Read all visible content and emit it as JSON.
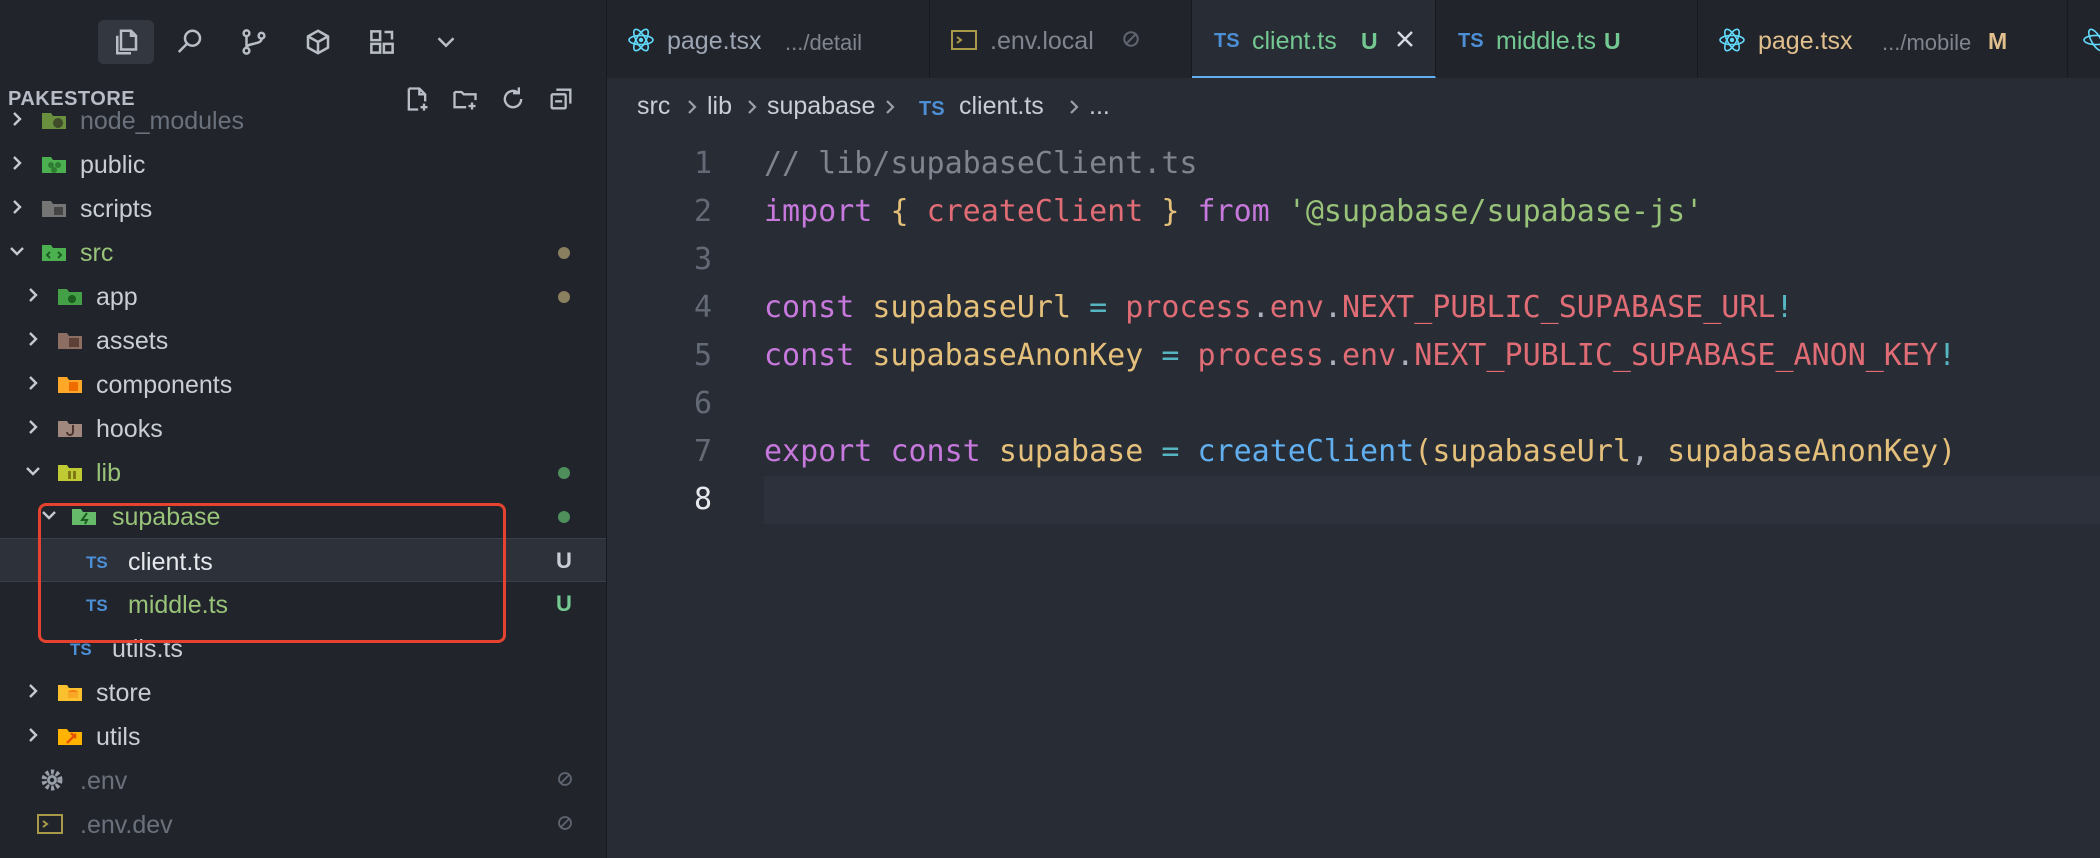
{
  "sidebar": {
    "explorer_title": "PAKESTORE",
    "activity_icons": [
      "explorer-icon",
      "search-icon",
      "source-control-icon",
      "extensions-icon",
      "remote-explorer-icon",
      "more-chevron-icon"
    ],
    "header_actions": [
      "new-file-icon",
      "new-folder-icon",
      "refresh-icon",
      "collapse-all-icon"
    ],
    "tree": [
      {
        "label": "node_modules",
        "type": "folder",
        "expanded": false
      },
      {
        "label": "public",
        "type": "folder",
        "expanded": false
      },
      {
        "label": "scripts",
        "type": "folder",
        "expanded": false
      },
      {
        "label": "src",
        "type": "folder",
        "expanded": true
      },
      {
        "label": "app",
        "type": "folder",
        "expanded": false
      },
      {
        "label": "assets",
        "type": "folder",
        "expanded": false
      },
      {
        "label": "components",
        "type": "folder",
        "expanded": false
      },
      {
        "label": "hooks",
        "type": "folder",
        "expanded": false
      },
      {
        "label": "lib",
        "type": "folder",
        "expanded": true
      },
      {
        "label": "supabase",
        "type": "folder",
        "expanded": true
      },
      {
        "label": "client.ts",
        "type": "file",
        "lang_badge": "TS",
        "status": "U",
        "selected": true
      },
      {
        "label": "middle.ts",
        "type": "file",
        "lang_badge": "TS",
        "status": "U"
      },
      {
        "label": "utils.ts",
        "type": "file",
        "lang_badge": "TS"
      },
      {
        "label": "store",
        "type": "folder",
        "expanded": false
      },
      {
        "label": "utils",
        "type": "folder",
        "expanded": false
      },
      {
        "label": ".env",
        "type": "file",
        "ignored": true
      },
      {
        "label": ".env.dev",
        "type": "file",
        "ignored": true
      }
    ],
    "status_colors": {
      "untracked": "#73c991",
      "modified_dot": "#8a7f5e",
      "green_dot": "#4e8f5c"
    }
  },
  "tabs": [
    {
      "label": "page.tsx",
      "description": ".../detail",
      "icon": "react-icon"
    },
    {
      "label": ".env.local",
      "icon": "terminal-icon"
    },
    {
      "label": "client.ts",
      "status": "U",
      "icon": "ts-icon",
      "lang_badge": "TS",
      "active": true
    },
    {
      "label": "middle.ts",
      "status": "U",
      "icon": "ts-icon",
      "lang_badge": "TS"
    },
    {
      "label": "page.tsx",
      "description": ".../mobile",
      "status": "M",
      "icon": "react-icon"
    }
  ],
  "breadcrumb": {
    "items": [
      "src",
      "lib",
      "supabase",
      "client.ts",
      "..."
    ],
    "lang_badge": "TS"
  },
  "code": {
    "current_line": 8,
    "lines": [
      {
        "number": "1",
        "tokens": [
          {
            "t": "// lib/supabaseClient.ts",
            "c": "com"
          }
        ]
      },
      {
        "number": "2",
        "tokens": [
          {
            "t": "import",
            "c": "kw"
          },
          {
            "t": " ",
            "c": "plain"
          },
          {
            "t": "{",
            "c": "punc"
          },
          {
            "t": " ",
            "c": "plain"
          },
          {
            "t": "createClient",
            "c": "red"
          },
          {
            "t": " ",
            "c": "plain"
          },
          {
            "t": "}",
            "c": "punc"
          },
          {
            "t": " ",
            "c": "plain"
          },
          {
            "t": "from",
            "c": "kw"
          },
          {
            "t": " ",
            "c": "plain"
          },
          {
            "t": "'@supabase/supabase-js'",
            "c": "str"
          }
        ]
      },
      {
        "number": "3",
        "tokens": []
      },
      {
        "number": "4",
        "tokens": [
          {
            "t": "const",
            "c": "kw"
          },
          {
            "t": " ",
            "c": "plain"
          },
          {
            "t": "supabaseUrl",
            "c": "id"
          },
          {
            "t": " ",
            "c": "plain"
          },
          {
            "t": "=",
            "c": "op"
          },
          {
            "t": " ",
            "c": "plain"
          },
          {
            "t": "process",
            "c": "red"
          },
          {
            "t": ".",
            "c": "plain"
          },
          {
            "t": "env",
            "c": "red"
          },
          {
            "t": ".",
            "c": "plain"
          },
          {
            "t": "NEXT_PUBLIC_SUPABASE_URL",
            "c": "red"
          },
          {
            "t": "!",
            "c": "op"
          }
        ]
      },
      {
        "number": "5",
        "tokens": [
          {
            "t": "const",
            "c": "kw"
          },
          {
            "t": " ",
            "c": "plain"
          },
          {
            "t": "supabaseAnonKey",
            "c": "id"
          },
          {
            "t": " ",
            "c": "plain"
          },
          {
            "t": "=",
            "c": "op"
          },
          {
            "t": " ",
            "c": "plain"
          },
          {
            "t": "process",
            "c": "red"
          },
          {
            "t": ".",
            "c": "plain"
          },
          {
            "t": "env",
            "c": "red"
          },
          {
            "t": ".",
            "c": "plain"
          },
          {
            "t": "NEXT_PUBLIC_SUPABASE_ANON_KEY",
            "c": "red"
          },
          {
            "t": "!",
            "c": "op"
          }
        ]
      },
      {
        "number": "6",
        "tokens": []
      },
      {
        "number": "7",
        "tokens": [
          {
            "t": "export",
            "c": "kw"
          },
          {
            "t": " ",
            "c": "plain"
          },
          {
            "t": "const",
            "c": "kw"
          },
          {
            "t": " ",
            "c": "plain"
          },
          {
            "t": "supabase",
            "c": "id"
          },
          {
            "t": " ",
            "c": "plain"
          },
          {
            "t": "=",
            "c": "op"
          },
          {
            "t": " ",
            "c": "plain"
          },
          {
            "t": "createClient",
            "c": "fn"
          },
          {
            "t": "(",
            "c": "punc"
          },
          {
            "t": "supabaseUrl",
            "c": "id"
          },
          {
            "t": ", ",
            "c": "plain"
          },
          {
            "t": "supabaseAnonKey",
            "c": "id"
          },
          {
            "t": ")",
            "c": "punc"
          }
        ]
      },
      {
        "number": "8",
        "tokens": []
      }
    ]
  },
  "theme": {
    "accent": "#61afef",
    "annotation_box": "#e5432f",
    "untracked": "#73c991",
    "modified": "#e2c08d"
  }
}
